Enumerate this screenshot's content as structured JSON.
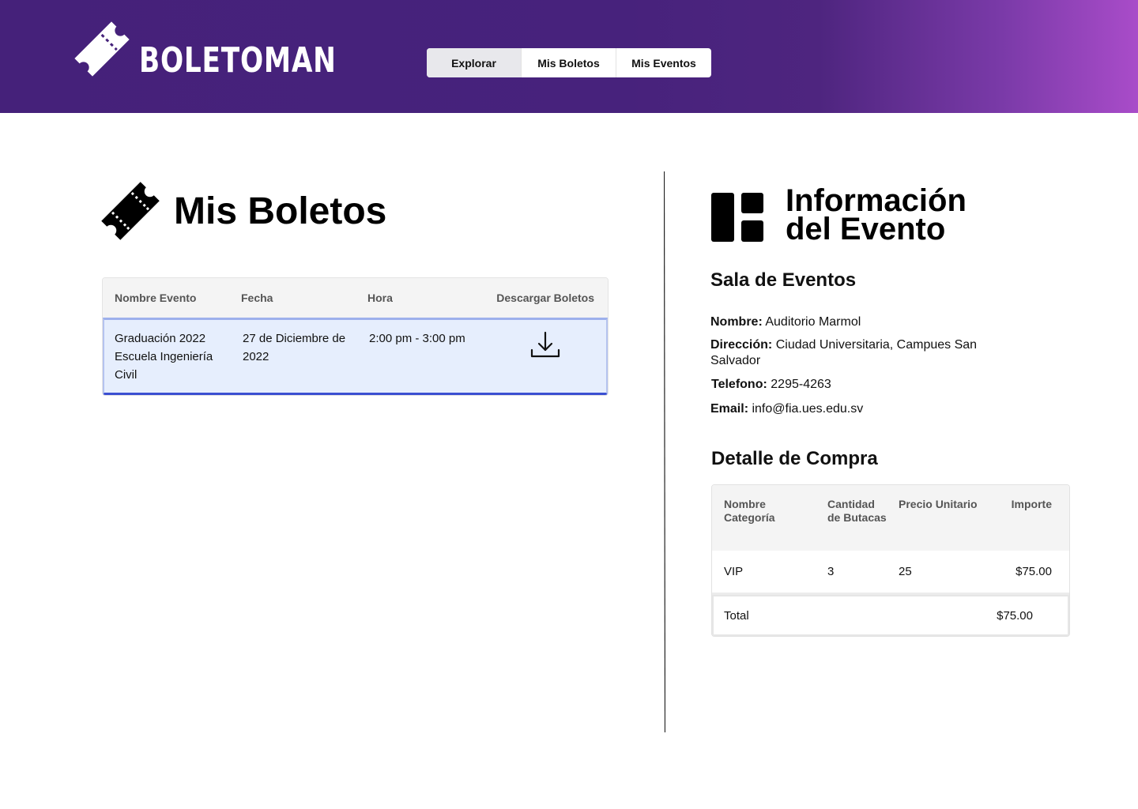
{
  "brand": {
    "name": "BOLETOMAN",
    "logo_icon": "ticket-icon"
  },
  "nav": {
    "items": [
      {
        "label": "Explorar",
        "active": true
      },
      {
        "label": "Mis Boletos",
        "active": false
      },
      {
        "label": "Mis Eventos",
        "active": false
      }
    ]
  },
  "tickets": {
    "title": "Mis Boletos",
    "icon": "ticket-icon",
    "columns": [
      "Nombre Evento",
      "Fecha",
      "Hora",
      "Descargar Boletos"
    ],
    "rows": [
      {
        "event_name": "Graduación 2022 Escuela Ingeniería Civil",
        "date": "27 de Diciembre de 2022",
        "time": "2:00 pm - 3:00 pm",
        "download_icon": "download-icon"
      }
    ]
  },
  "event_info": {
    "title_line1": "Información",
    "title_line2": "del Evento",
    "icon": "dashboard-icon",
    "venue_heading": "Sala de Eventos",
    "name_label": "Nombre:",
    "name_value": "Auditorio Marmol",
    "address_label": "Dirección:",
    "address_value": "Ciudad Universitaria, Campues San Salvador",
    "phone_label": "Telefono:",
    "phone_value": "2295-4263",
    "email_label": "Email:",
    "email_value": "info@fia.ues.edu.sv"
  },
  "purchase": {
    "title": "Detalle de Compra",
    "columns": [
      "Nombre Categoría",
      "Cantidad de Butacas",
      "Precio Unitario",
      "Importe"
    ],
    "rows": [
      {
        "category": "VIP",
        "quantity": "3",
        "unit_price": "25",
        "amount": "$75.00"
      }
    ],
    "total_label": "Total",
    "total_value": "$75.00"
  },
  "colors": {
    "header_start": "#45217a",
    "header_end": "#a94cc9",
    "row_highlight": "#e6eefd",
    "row_border": "#3b4fd1"
  }
}
